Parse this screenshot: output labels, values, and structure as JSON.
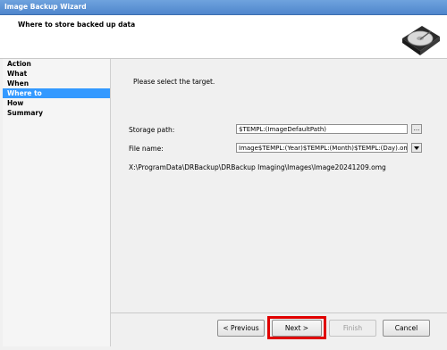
{
  "window": {
    "title": "Image Backup Wizard"
  },
  "header": {
    "title": "Where to store backed up data",
    "icon": "hard-drive-icon"
  },
  "sidebar": {
    "items": [
      {
        "label": "Action",
        "active": false
      },
      {
        "label": "What",
        "active": false
      },
      {
        "label": "When",
        "active": false
      },
      {
        "label": "Where to",
        "active": true
      },
      {
        "label": "How",
        "active": false
      },
      {
        "label": "Summary",
        "active": false
      }
    ]
  },
  "main": {
    "instruction": "Please select the target.",
    "storage_path": {
      "label": "Storage path:",
      "value": "$TEMPL:(ImageDefaultPath)",
      "browse_label": "..."
    },
    "file_name": {
      "label": "File name:",
      "value": "Image$TEMPL:(Year)$TEMPL:(Month)$TEMPL:(Day).omg",
      "dropdown_icon": "dropdown-arrow-icon"
    },
    "resolved_path": "X:\\ProgramData\\DRBackup\\DRBackup Imaging\\Images\\Image20241209.omg"
  },
  "buttons": {
    "previous": "< Previous",
    "next": "Next >",
    "finish": "Finish",
    "cancel": "Cancel"
  },
  "colors": {
    "accent": "#3399ff",
    "highlight": "#e00000"
  }
}
